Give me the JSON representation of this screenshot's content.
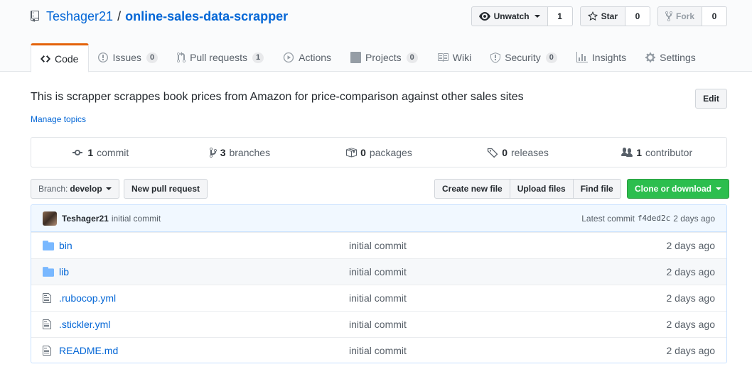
{
  "repo": {
    "owner": "Teshager21",
    "separator": "/",
    "name": "online-sales-data-scrapper"
  },
  "actions": {
    "watch": {
      "label": "Unwatch",
      "count": "1"
    },
    "star": {
      "label": "Star",
      "count": "0"
    },
    "fork": {
      "label": "Fork",
      "count": "0"
    }
  },
  "tabs": [
    {
      "label": "Code",
      "icon": "code-icon",
      "counter": ""
    },
    {
      "label": "Issues",
      "icon": "issue-icon",
      "counter": "0"
    },
    {
      "label": "Pull requests",
      "icon": "pull-request-icon",
      "counter": "1"
    },
    {
      "label": "Actions",
      "icon": "play-icon",
      "counter": ""
    },
    {
      "label": "Projects",
      "icon": "project-icon",
      "counter": "0"
    },
    {
      "label": "Wiki",
      "icon": "book-icon",
      "counter": ""
    },
    {
      "label": "Security",
      "icon": "shield-icon",
      "counter": "0"
    },
    {
      "label": "Insights",
      "icon": "graph-icon",
      "counter": ""
    },
    {
      "label": "Settings",
      "icon": "gear-icon",
      "counter": ""
    }
  ],
  "description": "This is scrapper scrappes book prices from Amazon for price-comparison against other sales sites",
  "manage_topics": "Manage topics",
  "edit_label": "Edit",
  "summary": {
    "commits": {
      "num": "1",
      "label": "commit"
    },
    "branches": {
      "num": "3",
      "label": "branches"
    },
    "packages": {
      "num": "0",
      "label": "packages"
    },
    "releases": {
      "num": "0",
      "label": "releases"
    },
    "contributors": {
      "num": "1",
      "label": "contributor"
    }
  },
  "toolbar": {
    "branch_prefix": "Branch:",
    "branch_name": "develop",
    "new_pr": "New pull request",
    "create_file": "Create new file",
    "upload_files": "Upload files",
    "find_file": "Find file",
    "clone": "Clone or download"
  },
  "latest_commit": {
    "author": "Teshager21",
    "message": "initial commit",
    "label": "Latest commit",
    "sha": "f4ded2c",
    "age": "2 days ago"
  },
  "files": [
    {
      "type": "dir",
      "name": "bin",
      "message": "initial commit",
      "age": "2 days ago"
    },
    {
      "type": "dir",
      "name": "lib",
      "message": "initial commit",
      "age": "2 days ago"
    },
    {
      "type": "file",
      "name": ".rubocop.yml",
      "message": "initial commit",
      "age": "2 days ago"
    },
    {
      "type": "file",
      "name": ".stickler.yml",
      "message": "initial commit",
      "age": "2 days ago"
    },
    {
      "type": "file",
      "name": "README.md",
      "message": "initial commit",
      "age": "2 days ago"
    }
  ],
  "colors": {
    "link": "#0366d6",
    "accent_tab": "#e36209",
    "clone_green": "#2cbe4e",
    "folder": "#79b8ff"
  }
}
